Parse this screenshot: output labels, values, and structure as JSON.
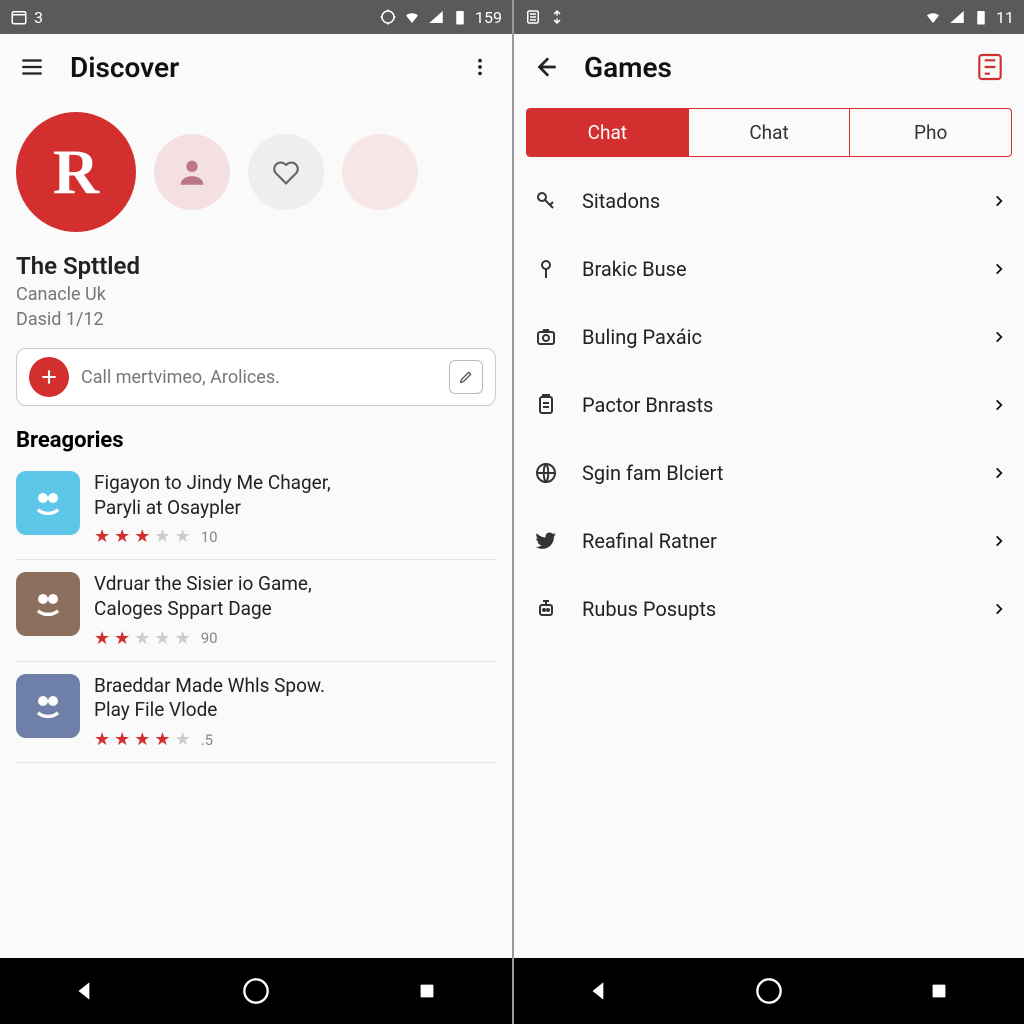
{
  "left": {
    "status": {
      "left_num": "3",
      "time": "159"
    },
    "header": {
      "title": "Discover"
    },
    "story_main_glyph": "R",
    "profile": {
      "name": "The Spttled",
      "sub": "Canacle Uk",
      "date": "Dasid 1/12"
    },
    "input": {
      "placeholder": "Call mertvimeo, Arolices."
    },
    "section_title": "Breagories",
    "games": [
      {
        "title_l1": "Figayon to Jindy Me Chager,",
        "title_l2": "Paryli at Osaypler",
        "stars": 3,
        "count": "10"
      },
      {
        "title_l1": "Vdruar the Sisier io Game,",
        "title_l2": "Caloges Sppart Dage",
        "stars": 2,
        "count": "90"
      },
      {
        "title_l1": "Braeddar Made Whls Spow.",
        "title_l2": "Play File Vlode",
        "stars": 4,
        "count": ".5"
      }
    ]
  },
  "right": {
    "status": {
      "time": "11"
    },
    "header": {
      "title": "Games"
    },
    "tabs": [
      {
        "label": "Chat",
        "active": true
      },
      {
        "label": "Chat",
        "active": false
      },
      {
        "label": "Pho",
        "active": false
      }
    ],
    "items": [
      {
        "icon": "key",
        "label": "Sitadons"
      },
      {
        "icon": "pin",
        "label": "Brakic Buse"
      },
      {
        "icon": "camera",
        "label": "Buling Paxáic"
      },
      {
        "icon": "clipboard",
        "label": "Pactor Bnrasts"
      },
      {
        "icon": "globe",
        "label": "Sgin fam Blciert"
      },
      {
        "icon": "bird",
        "label": "Reafinal Ratner"
      },
      {
        "icon": "robot",
        "label": "Rubus Posupts"
      }
    ]
  }
}
